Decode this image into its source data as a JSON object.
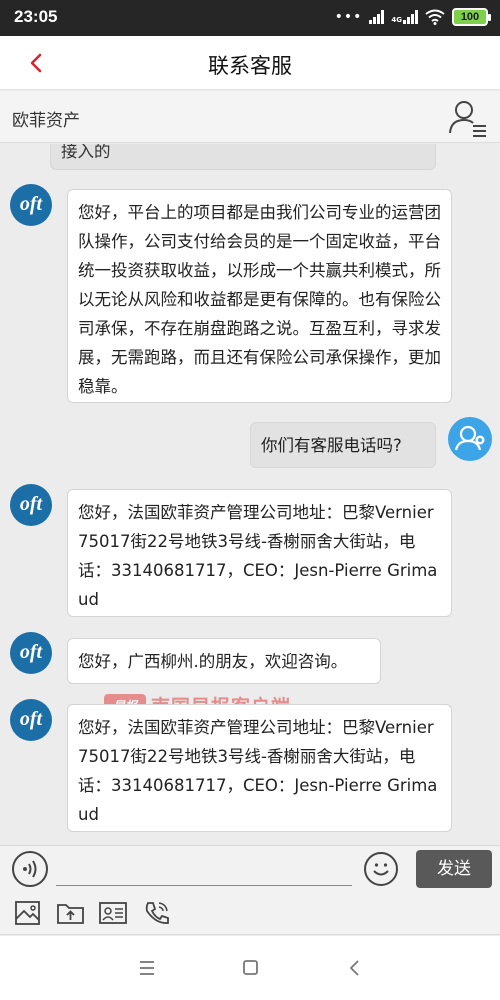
{
  "status_bar": {
    "time": "23:05",
    "network_label": "4G",
    "battery": "100"
  },
  "header": {
    "title": "联系客服",
    "back_icon": "chevron-left-icon"
  },
  "sub_header": {
    "company": "欧菲资产",
    "profile_icon": "user-list-icon"
  },
  "avatar_text": "oft",
  "messages": [
    {
      "from": "agent",
      "text": "接入的"
    },
    {
      "from": "agent",
      "text": "您好，平台上的项目都是由我们公司专业的运营团队操作，公司支付给会员的是一个固定收益，平台统一投资获取收益，以形成一个共赢共利模式，所以无论从风险和收益都是更有保障的。也有保险公司承保，不存在崩盘跑路之说。互盈互利，寻求发展，无需跑路，而且还有保险公司承保操作，更加稳靠。"
    },
    {
      "from": "user",
      "text": "你们有客服电话吗?"
    },
    {
      "from": "agent",
      "text": "您好，法国欧菲资产管理公司地址：巴黎Vernier 75017街22号地铁3号线-香榭丽舍大街站，电话：33140681717，CEO：Jesn-Pierre Grimaud"
    },
    {
      "from": "agent",
      "text": "您好，广西柳州.的朋友，欢迎咨询。"
    },
    {
      "from": "agent",
      "text": "您好，法国欧菲资产管理公司地址：巴黎Vernier 75017街22号地铁3号线-香榭丽舍大街站，电话：33140681717，CEO：Jesn-Pierre Grimaud"
    }
  ],
  "watermark": {
    "logo_text": "早报",
    "text": "南国早报客户端"
  },
  "input_bar": {
    "value": "",
    "send_label": "发送"
  },
  "colors": {
    "accent": "#d8232a",
    "agent_avatar": "#1c6fa6",
    "user_avatar": "#3da4e8",
    "send_button": "#595959"
  },
  "icons": {
    "tools": [
      "image-icon",
      "upload-folder-icon",
      "id-card-icon",
      "phone-icon"
    ],
    "nav": [
      "menu-icon",
      "home-square-icon",
      "back-triangle-icon"
    ]
  }
}
